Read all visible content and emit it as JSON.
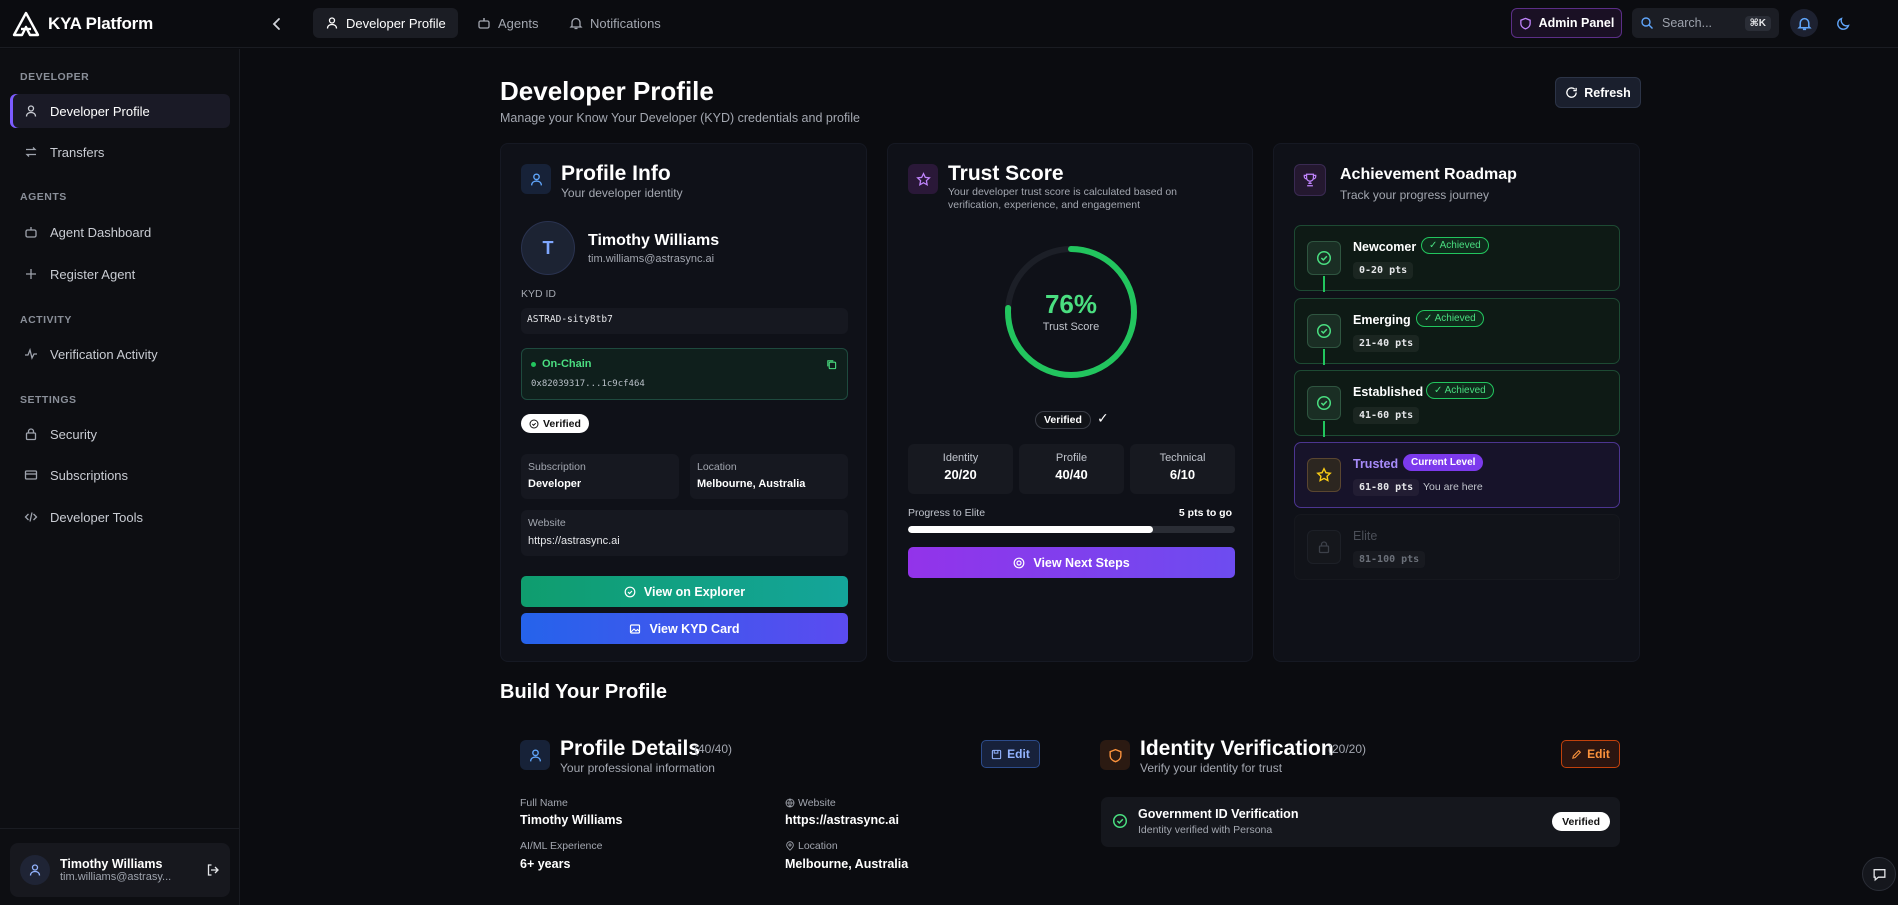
{
  "brand": {
    "name": "KYA Platform",
    "logo_icon": "triangle-logo"
  },
  "topnav": {
    "tabs": [
      {
        "label": "Developer Profile",
        "icon": "user-icon",
        "active": true
      },
      {
        "label": "Agents",
        "icon": "bot-icon",
        "active": false
      },
      {
        "label": "Notifications",
        "icon": "bell-icon",
        "active": false
      }
    ],
    "admin_label": "Admin Panel",
    "search_placeholder": "Search...",
    "search_shortcut": "⌘K"
  },
  "sidebar": {
    "sections": [
      {
        "title": "DEVELOPER",
        "items": [
          {
            "label": "Developer Profile",
            "icon": "user-icon",
            "active": true
          },
          {
            "label": "Transfers",
            "icon": "transfer-icon"
          }
        ]
      },
      {
        "title": "AGENTS",
        "items": [
          {
            "label": "Agent Dashboard",
            "icon": "bot-icon"
          },
          {
            "label": "Register Agent",
            "icon": "plus-icon"
          }
        ]
      },
      {
        "title": "ACTIVITY",
        "items": [
          {
            "label": "Verification Activity",
            "icon": "activity-icon"
          }
        ]
      },
      {
        "title": "SETTINGS",
        "items": [
          {
            "label": "Security",
            "icon": "lock-icon"
          },
          {
            "label": "Subscriptions",
            "icon": "credit-card-icon"
          },
          {
            "label": "Developer Tools",
            "icon": "code-icon"
          }
        ]
      }
    ],
    "user": {
      "name": "Timothy Williams",
      "email": "tim.williams@astrasy..."
    }
  },
  "page": {
    "title": "Developer Profile",
    "subtitle": "Manage your Know Your Developer (KYD) credentials and profile",
    "refresh_label": "Refresh"
  },
  "profile_info": {
    "title": "Profile Info",
    "subtitle": "Your developer identity",
    "avatar_initial": "T",
    "name": "Timothy Williams",
    "email": "tim.williams@astrasync.ai",
    "kyd_label": "KYD ID",
    "kyd_id": "ASTRAD-sity8tb7",
    "onchain_label": "On-Chain",
    "onchain_address": "0x82039317...1c9cf464",
    "verified_label": "Verified",
    "subscription_label": "Subscription",
    "subscription_value": "Developer",
    "location_label": "Location",
    "location_value": "Melbourne, Australia",
    "website_label": "Website",
    "website_value": "https://astrasync.ai",
    "explorer_btn": "View on Explorer",
    "kyd_card_btn": "View KYD Card"
  },
  "trust_score": {
    "title": "Trust Score",
    "subtitle_line1": "Your developer trust score is calculated based on",
    "subtitle_line2": "verification, experience, and engagement",
    "score_text": "76%",
    "score_value": 76,
    "score_label": "Trust Score",
    "verified_label": "Verified",
    "check_mark": "✓",
    "stats": [
      {
        "label": "Identity",
        "value": "20/20"
      },
      {
        "label": "Profile",
        "value": "40/40"
      },
      {
        "label": "Technical",
        "value": "6/10"
      }
    ],
    "progress_label": "Progress to Elite",
    "progress_togo": "5 pts to go",
    "progress_fraction": 0.75,
    "next_steps_btn": "View Next Steps"
  },
  "roadmap": {
    "title": "Achievement Roadmap",
    "subtitle": "Track your progress journey",
    "levels": [
      {
        "name": "Newcomer",
        "badge": "✓ Achieved",
        "pts": "0-20 pts",
        "state": "achieved"
      },
      {
        "name": "Emerging",
        "badge": "✓ Achieved",
        "pts": "21-40 pts",
        "state": "achieved"
      },
      {
        "name": "Established",
        "badge": "✓ Achieved",
        "pts": "41-60 pts",
        "state": "achieved"
      },
      {
        "name": "Trusted",
        "badge": "Current Level",
        "pts": "61-80 pts",
        "note": "You are here",
        "state": "current"
      },
      {
        "name": "Elite",
        "pts": "81-100 pts",
        "state": "locked"
      }
    ]
  },
  "build": {
    "title": "Build Your Profile",
    "profile_details": {
      "title": "Profile Details",
      "score": "(40/40)",
      "subtitle": "Your professional information",
      "edit_label": "Edit",
      "full_name_label": "Full Name",
      "full_name": "Timothy Williams",
      "website_label": "Website",
      "website": "https://astrasync.ai",
      "experience_label": "AI/ML Experience",
      "experience": "6+ years",
      "location_label": "Location",
      "location": "Melbourne, Australia"
    },
    "identity": {
      "title": "Identity Verification",
      "score": "(20/20)",
      "subtitle": "Verify your identity for trust",
      "edit_label": "Edit",
      "gov_title": "Government ID Verification",
      "gov_sub": "Identity verified with Persona",
      "gov_badge": "Verified"
    }
  },
  "colors": {
    "accent": "#7c3aed",
    "success": "#22c55e",
    "blue": "#3b82f6",
    "orange": "#f97316"
  }
}
